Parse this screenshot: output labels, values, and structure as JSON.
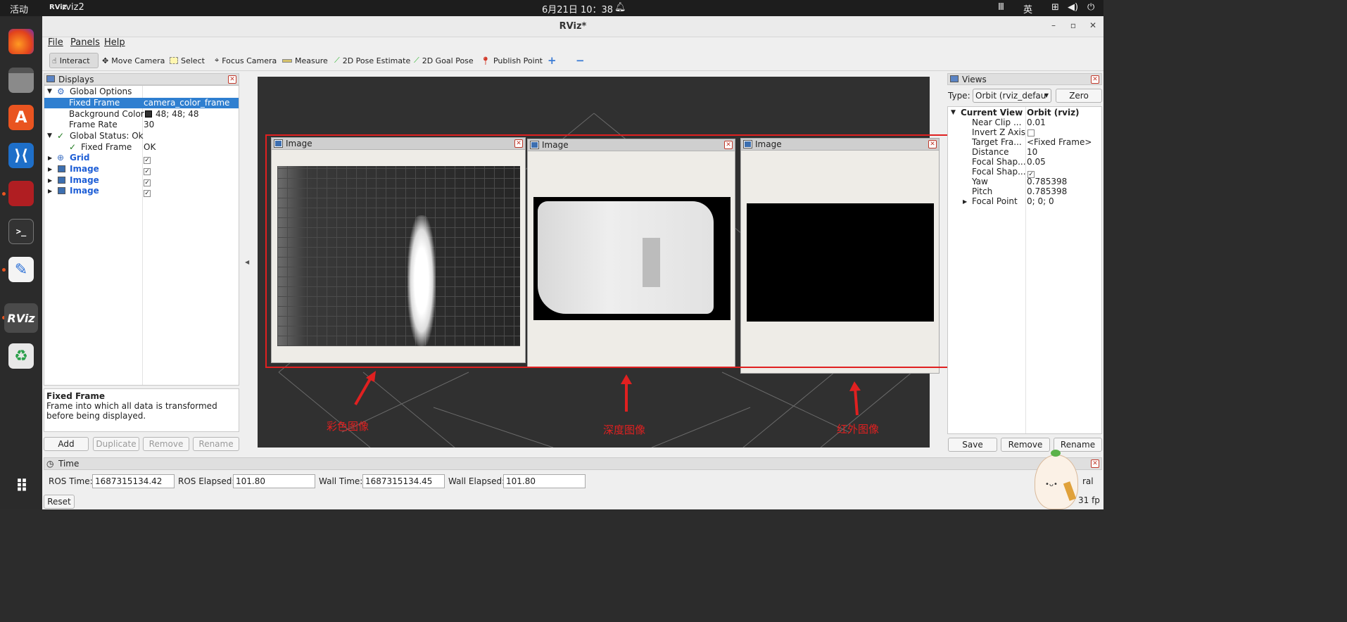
{
  "topbar": {
    "activities": "活动",
    "app_name": "rviz2",
    "clock": "6月21日 10：38",
    "input_method": "英",
    "keyboard_indicator": "Ⅲ"
  },
  "window": {
    "title": "RViz*"
  },
  "menu": [
    "File",
    "Panels",
    "Help"
  ],
  "toolbar": {
    "items": [
      "Interact",
      "Move Camera",
      "Select",
      "Focus Camera",
      "Measure",
      "2D Pose Estimate",
      "2D Goal Pose",
      "Publish Point"
    ],
    "active": "Interact"
  },
  "displays": {
    "title": "Displays",
    "rows": [
      {
        "key": "Global Options",
        "value": ""
      },
      {
        "key": "Fixed Frame",
        "value": "camera_color_frame"
      },
      {
        "key": "Background Color",
        "value": "48; 48; 48"
      },
      {
        "key": "Frame Rate",
        "value": "30"
      },
      {
        "key": "Global Status: Ok",
        "value": ""
      },
      {
        "key": "Fixed Frame",
        "value": "OK"
      },
      {
        "key": "Grid",
        "value": "checked"
      },
      {
        "key": "Image",
        "value": "checked"
      },
      {
        "key": "Image",
        "value": "checked"
      },
      {
        "key": "Image",
        "value": "checked"
      }
    ],
    "desc_title": "Fixed Frame",
    "desc_body": "Frame into which all data is transformed before being displayed.",
    "buttons": [
      "Add",
      "Duplicate",
      "Remove",
      "Rename"
    ]
  },
  "image_panels": [
    {
      "title": "Image"
    },
    {
      "title": "Image"
    },
    {
      "title": "Image"
    }
  ],
  "annotations": [
    "彩色图像",
    "深度图像",
    "红外图像"
  ],
  "views": {
    "title": "Views",
    "type_label": "Type:",
    "type_value": "Orbit (rviz_defau",
    "zero_label": "Zero",
    "header_key": "Current View",
    "header_value": "Orbit (rviz)",
    "rows": [
      {
        "key": "Near Clip ...",
        "value": "0.01"
      },
      {
        "key": "Invert Z Axis",
        "value": ""
      },
      {
        "key": "Target Fra...",
        "value": "<Fixed Frame>"
      },
      {
        "key": "Distance",
        "value": "10"
      },
      {
        "key": "Focal Shap...",
        "value": "0.05"
      },
      {
        "key": "Focal Shap...",
        "value": "✓"
      },
      {
        "key": "Yaw",
        "value": "0.785398"
      },
      {
        "key": "Pitch",
        "value": "0.785398"
      },
      {
        "key": "Focal Point",
        "value": "0; 0; 0"
      }
    ],
    "buttons": [
      "Save",
      "Remove",
      "Rename"
    ]
  },
  "time": {
    "title": "Time",
    "ros_time_label": "ROS Time:",
    "ros_time": "1687315134.42",
    "ros_elapsed_label": "ROS Elapsed:",
    "ros_elapsed": "101.80",
    "wall_time_label": "Wall Time:",
    "wall_time": "1687315134.45",
    "wall_elapsed_label": "Wall Elapsed:",
    "wall_elapsed": "101.80",
    "reset_label": "Reset",
    "fps": "31 fp",
    "partial_right": "ral"
  },
  "colors": {
    "annotation_red": "#e02020",
    "selected_row": "#2f7fd0",
    "viewport_bg": "#303030"
  }
}
